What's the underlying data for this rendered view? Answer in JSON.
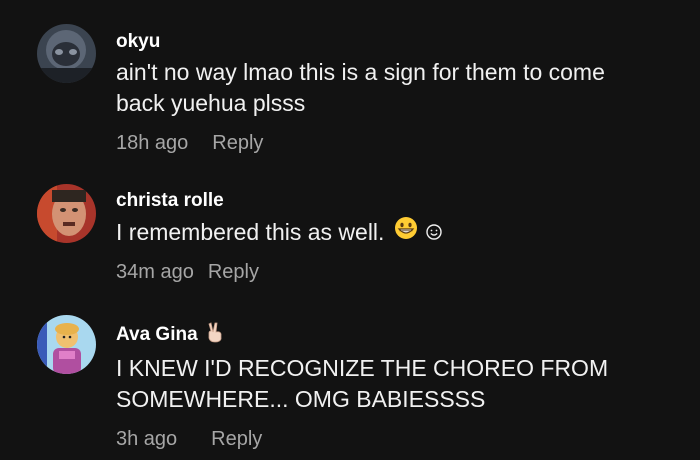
{
  "comments": [
    {
      "author": "okyu",
      "text": "ain't no way lmao this is a sign for them to come back yuehua plsss",
      "time": "18h ago",
      "reply_label": "Reply"
    },
    {
      "author": "christa rolle",
      "text": "I remembered this as well.",
      "emojis": [
        "grinning-face-icon",
        "smiley-icon"
      ],
      "time": "34m ago",
      "reply_label": "Reply"
    },
    {
      "author": "Ava Gina",
      "author_badge": "victory-hand-icon",
      "text": "I KNEW I'D RECOGNIZE THE CHOREO FROM SOMEWHERE... OMG BABIESSSS",
      "time": "3h ago",
      "reply_label": "Reply"
    }
  ],
  "colors": {
    "background": "#121212",
    "author": "#ffffff",
    "text": "#f1f1f1",
    "meta": "#a6a6a6"
  }
}
